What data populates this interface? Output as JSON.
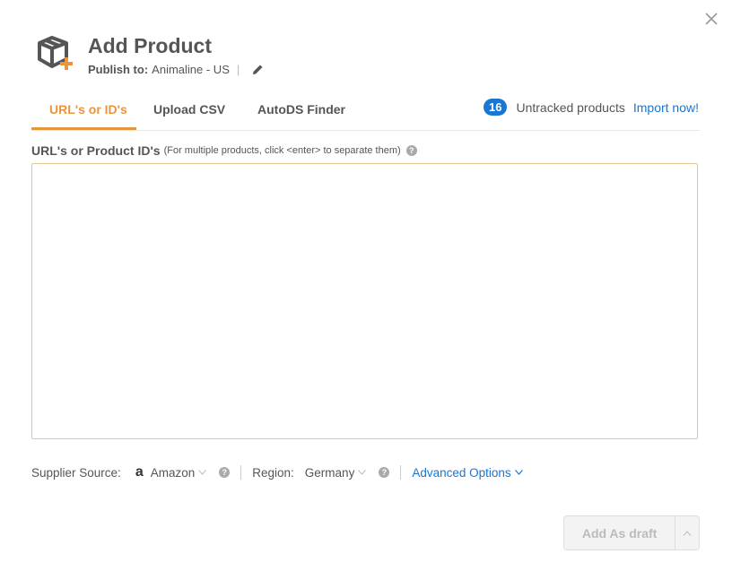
{
  "header": {
    "title": "Add Product",
    "publish_label": "Publish to:",
    "publish_value": "Animaline - US"
  },
  "tabs": [
    {
      "label": "URL's or ID's",
      "active": true
    },
    {
      "label": "Upload CSV",
      "active": false
    },
    {
      "label": "AutoDS Finder",
      "active": false
    }
  ],
  "untracked": {
    "count": "16",
    "text": "Untracked products",
    "link": "Import now!"
  },
  "field": {
    "label": "URL's or Product ID's",
    "hint": "(For multiple products, click <enter> to separate them)",
    "help_icon": "?",
    "value": ""
  },
  "options": {
    "supplier_label": "Supplier Source:",
    "supplier_icon": "a",
    "supplier_value": "Amazon",
    "region_label": "Region:",
    "region_value": "Germany",
    "advanced_label": "Advanced Options"
  },
  "footer": {
    "primary_label": "Add As draft"
  },
  "colors": {
    "accent": "#e8963e",
    "link": "#1976d2"
  }
}
